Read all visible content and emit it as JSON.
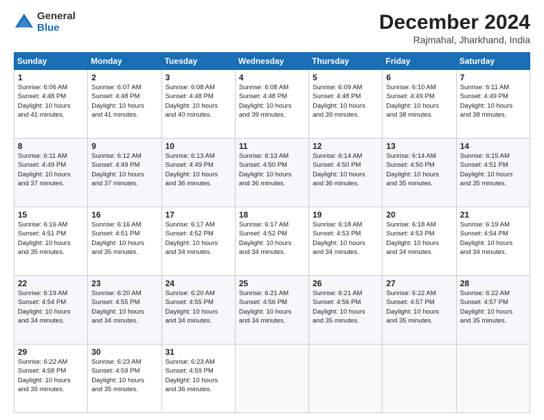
{
  "logo": {
    "general": "General",
    "blue": "Blue"
  },
  "title": {
    "month": "December 2024",
    "location": "Rajmahal, Jharkhand, India"
  },
  "days_header": [
    "Sunday",
    "Monday",
    "Tuesday",
    "Wednesday",
    "Thursday",
    "Friday",
    "Saturday"
  ],
  "weeks": [
    [
      {
        "day": "1",
        "sunrise": "6:06 AM",
        "sunset": "4:48 PM",
        "daylight": "10 hours and 41 minutes."
      },
      {
        "day": "2",
        "sunrise": "6:07 AM",
        "sunset": "4:48 PM",
        "daylight": "10 hours and 41 minutes."
      },
      {
        "day": "3",
        "sunrise": "6:08 AM",
        "sunset": "4:48 PM",
        "daylight": "10 hours and 40 minutes."
      },
      {
        "day": "4",
        "sunrise": "6:08 AM",
        "sunset": "4:48 PM",
        "daylight": "10 hours and 39 minutes."
      },
      {
        "day": "5",
        "sunrise": "6:09 AM",
        "sunset": "4:48 PM",
        "daylight": "10 hours and 39 minutes."
      },
      {
        "day": "6",
        "sunrise": "6:10 AM",
        "sunset": "4:49 PM",
        "daylight": "10 hours and 38 minutes."
      },
      {
        "day": "7",
        "sunrise": "6:11 AM",
        "sunset": "4:49 PM",
        "daylight": "10 hours and 38 minutes."
      }
    ],
    [
      {
        "day": "8",
        "sunrise": "6:11 AM",
        "sunset": "4:49 PM",
        "daylight": "10 hours and 37 minutes."
      },
      {
        "day": "9",
        "sunrise": "6:12 AM",
        "sunset": "4:49 PM",
        "daylight": "10 hours and 37 minutes."
      },
      {
        "day": "10",
        "sunrise": "6:13 AM",
        "sunset": "4:49 PM",
        "daylight": "10 hours and 36 minutes."
      },
      {
        "day": "11",
        "sunrise": "6:13 AM",
        "sunset": "4:50 PM",
        "daylight": "10 hours and 36 minutes."
      },
      {
        "day": "12",
        "sunrise": "6:14 AM",
        "sunset": "4:50 PM",
        "daylight": "10 hours and 36 minutes."
      },
      {
        "day": "13",
        "sunrise": "6:14 AM",
        "sunset": "4:50 PM",
        "daylight": "10 hours and 35 minutes."
      },
      {
        "day": "14",
        "sunrise": "6:15 AM",
        "sunset": "4:51 PM",
        "daylight": "10 hours and 35 minutes."
      }
    ],
    [
      {
        "day": "15",
        "sunrise": "6:16 AM",
        "sunset": "4:51 PM",
        "daylight": "10 hours and 35 minutes."
      },
      {
        "day": "16",
        "sunrise": "6:16 AM",
        "sunset": "4:51 PM",
        "daylight": "10 hours and 35 minutes."
      },
      {
        "day": "17",
        "sunrise": "6:17 AM",
        "sunset": "4:52 PM",
        "daylight": "10 hours and 34 minutes."
      },
      {
        "day": "18",
        "sunrise": "6:17 AM",
        "sunset": "4:52 PM",
        "daylight": "10 hours and 34 minutes."
      },
      {
        "day": "19",
        "sunrise": "6:18 AM",
        "sunset": "4:53 PM",
        "daylight": "10 hours and 34 minutes."
      },
      {
        "day": "20",
        "sunrise": "6:18 AM",
        "sunset": "4:53 PM",
        "daylight": "10 hours and 34 minutes."
      },
      {
        "day": "21",
        "sunrise": "6:19 AM",
        "sunset": "4:54 PM",
        "daylight": "10 hours and 34 minutes."
      }
    ],
    [
      {
        "day": "22",
        "sunrise": "6:19 AM",
        "sunset": "4:54 PM",
        "daylight": "10 hours and 34 minutes."
      },
      {
        "day": "23",
        "sunrise": "6:20 AM",
        "sunset": "4:55 PM",
        "daylight": "10 hours and 34 minutes."
      },
      {
        "day": "24",
        "sunrise": "6:20 AM",
        "sunset": "4:55 PM",
        "daylight": "10 hours and 34 minutes."
      },
      {
        "day": "25",
        "sunrise": "6:21 AM",
        "sunset": "4:56 PM",
        "daylight": "10 hours and 34 minutes."
      },
      {
        "day": "26",
        "sunrise": "6:21 AM",
        "sunset": "4:56 PM",
        "daylight": "10 hours and 35 minutes."
      },
      {
        "day": "27",
        "sunrise": "6:22 AM",
        "sunset": "4:57 PM",
        "daylight": "10 hours and 35 minutes."
      },
      {
        "day": "28",
        "sunrise": "6:22 AM",
        "sunset": "4:57 PM",
        "daylight": "10 hours and 35 minutes."
      }
    ],
    [
      {
        "day": "29",
        "sunrise": "6:22 AM",
        "sunset": "4:58 PM",
        "daylight": "10 hours and 35 minutes."
      },
      {
        "day": "30",
        "sunrise": "6:23 AM",
        "sunset": "4:59 PM",
        "daylight": "10 hours and 35 minutes."
      },
      {
        "day": "31",
        "sunrise": "6:23 AM",
        "sunset": "4:59 PM",
        "daylight": "10 hours and 36 minutes."
      },
      null,
      null,
      null,
      null
    ]
  ],
  "cell_labels": {
    "sunrise": "Sunrise:",
    "sunset": "Sunset:",
    "daylight": "Daylight:"
  }
}
